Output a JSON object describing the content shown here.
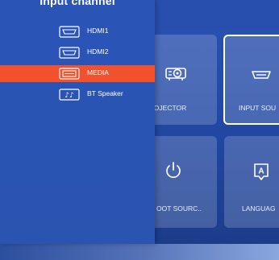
{
  "colors": {
    "panel_bg": "#2a54b6",
    "selected_bg": "#f1512d",
    "tile_bg": "rgba(255,255,255,0.18)",
    "text": "#ffffff"
  },
  "panel": {
    "title": "Input channel",
    "items": [
      {
        "label": "HDMI1",
        "icon": "hdmi-port-icon",
        "selected": false
      },
      {
        "label": "HDMI2",
        "icon": "hdmi-port-icon",
        "selected": false
      },
      {
        "label": "MEDIA",
        "icon": "media-icon",
        "selected": true
      },
      {
        "label": "BT Speaker",
        "icon": "music-notes-icon",
        "selected": false
      }
    ]
  },
  "tiles": [
    {
      "label": "PROJECTOR",
      "icon": "projector-icon"
    },
    {
      "label": "INPUT SOU",
      "icon": "input-source-icon",
      "focused": true
    },
    {
      "label": "OOT SOURC..",
      "icon": "power-icon"
    },
    {
      "label": "LANGUAG",
      "icon": "language-icon"
    }
  ]
}
